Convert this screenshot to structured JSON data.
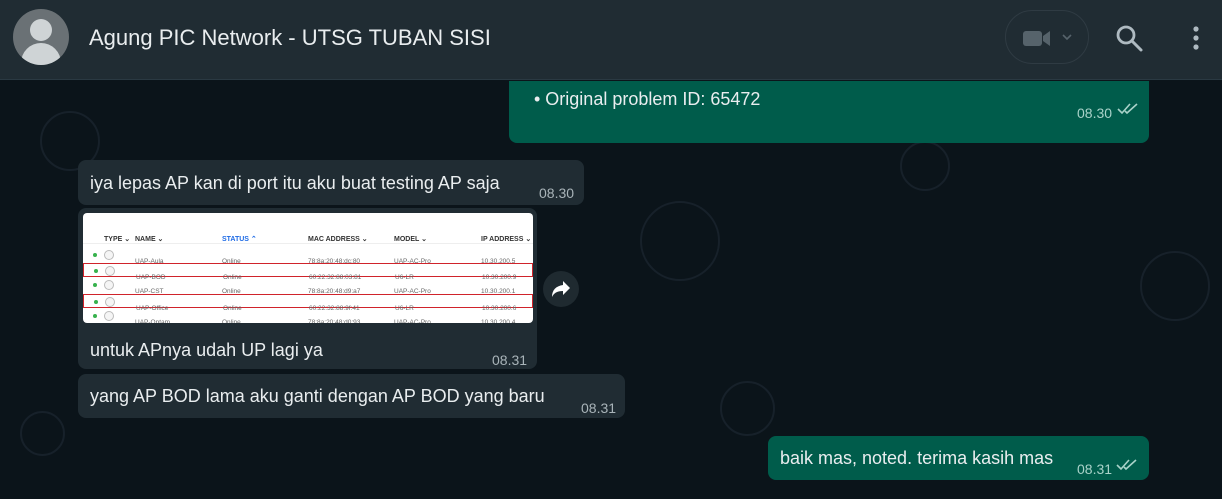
{
  "header": {
    "title": "Agung PIC Network - UTSG TUBAN SISI",
    "icons": [
      "avatar",
      "video-call-icon",
      "chevron-down-icon",
      "search-icon",
      "menu-icon"
    ]
  },
  "messages": [
    {
      "id": "m1",
      "direction": "out",
      "text": "• Original problem ID: 65472",
      "time": "08.30",
      "status": "read"
    },
    {
      "id": "m2",
      "direction": "in",
      "text": "iya lepas AP kan di port itu aku buat testing AP saja",
      "time": "08.30"
    },
    {
      "id": "m3",
      "direction": "in",
      "type": "image",
      "caption": "untuk APnya udah UP lagi ya",
      "time": "08.31"
    },
    {
      "id": "m4",
      "direction": "in",
      "text": "yang AP BOD lama aku ganti dengan AP BOD yang baru",
      "time": "08.31"
    },
    {
      "id": "m5",
      "direction": "out",
      "text": "baik mas, noted. terima kasih mas",
      "time": "08.31",
      "status": "read"
    }
  ],
  "image_table": {
    "headers": [
      "TYPE",
      "NAME",
      "STATUS",
      "MAC ADDRESS",
      "MODEL",
      "IP ADDRESS"
    ],
    "rows": [
      {
        "name": "UAP-Aula",
        "status": "Online",
        "mac": "78:8a:20:48:dc:80",
        "model": "UAP-AC-Pro",
        "ip": "10.30.200.5",
        "highlight": false
      },
      {
        "name": "UAP-BOD",
        "status": "Online",
        "mac": "60:22:32:88:03:81",
        "model": "U6-LR",
        "ip": "10.30.200.9",
        "highlight": true
      },
      {
        "name": "UAP-CST",
        "status": "Online",
        "mac": "78:8a:20:48:d9:a7",
        "model": "UAP-AC-Pro",
        "ip": "10.30.200.1",
        "highlight": false
      },
      {
        "name": "UAP-Office",
        "status": "Online",
        "mac": "60:22:32:88:9f:41",
        "model": "U6-LR",
        "ip": "10.30.200.6",
        "highlight": true
      },
      {
        "name": "UAP-Optam",
        "status": "Online",
        "mac": "78:8a:20:48:d0:93",
        "model": "UAP-AC-Pro",
        "ip": "10.30.200.4",
        "highlight": false
      }
    ]
  },
  "colors": {
    "header_bg": "#202c33",
    "chat_bg": "#0b141a",
    "incoming_bubble": "#202c33",
    "outgoing_bubble": "#005c4b",
    "read_ticks": "#a9d2c9",
    "highlight_box": "#d0232b"
  }
}
